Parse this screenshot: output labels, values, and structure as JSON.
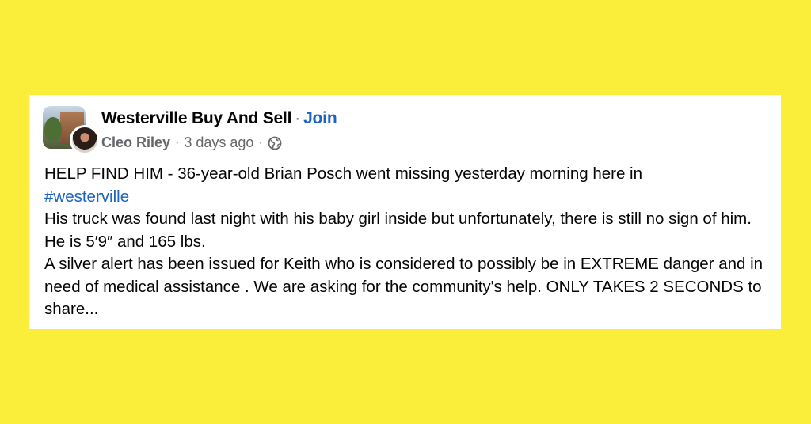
{
  "group": {
    "name": "Westerville Buy And Sell",
    "separator": "·",
    "join_label": "Join"
  },
  "post": {
    "author": "Cleo Riley",
    "timestamp": "3 days ago",
    "meta_separator": "·",
    "audience_icon": "globe-icon",
    "line1": "HELP FIND HIM -   36-year-old Brian Posch went missing yesterday morning here in",
    "hashtag": "#westerville",
    "paragraph2": "His truck was found last night with his baby girl inside but unfortunately, there is still no sign of him. He is 5′9″ and 165 lbs.",
    "paragraph3": "A silver alert has been issued for Keith who is considered to possibly be in EXTREME danger and in need of medical assistance . We are asking for the community's help. ONLY TAKES 2 SECONDS to share..."
  },
  "colors": {
    "background": "#fbee3b",
    "card": "#ffffff",
    "link": "#1b64c4",
    "text": "#050505",
    "muted": "#65676b"
  }
}
